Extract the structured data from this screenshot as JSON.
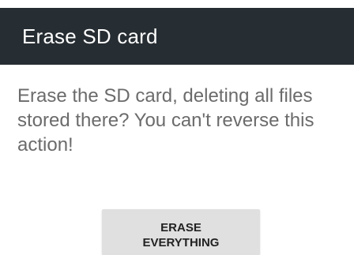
{
  "dialog": {
    "title": "Erase SD card",
    "message": "Erase the SD card, deleting all files stored there? You can't reverse this action!",
    "button": {
      "line1": "ERASE",
      "line2": "EVERYTHING"
    }
  },
  "colors": {
    "titlebar": "#262d33",
    "title_text": "#ffffff",
    "message_text": "#6b6b6b",
    "button_bg": "#e0e0e0"
  }
}
